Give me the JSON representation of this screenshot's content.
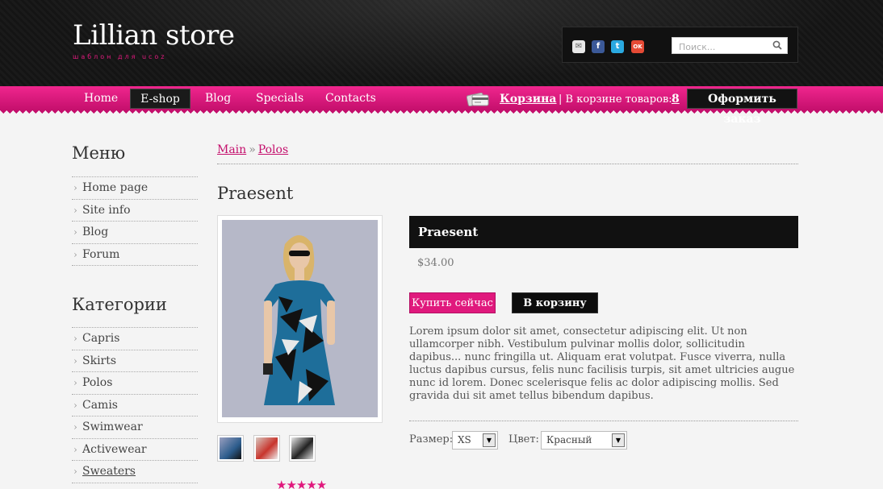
{
  "header": {
    "title": "Lillian store",
    "subtitle": "шаблон для ucoz",
    "search": {
      "placeholder": "Поиск..."
    },
    "social_icons": [
      "mail-icon",
      "facebook-icon",
      "twitter-icon",
      "odnoklassniki-icon"
    ]
  },
  "nav": {
    "items": [
      {
        "label": "Home",
        "active": false
      },
      {
        "label": "E-shop",
        "active": true
      },
      {
        "label": "Blog",
        "active": false
      },
      {
        "label": "Specials",
        "active": false
      },
      {
        "label": "Contacts",
        "active": false
      }
    ]
  },
  "cart": {
    "link": "Корзина",
    "count_label": "| В корзине товаров:",
    "count": "8",
    "checkout": "Оформить заказ"
  },
  "sidebar": {
    "menu_title": "Меню",
    "menu_items": [
      "Home page",
      "Site info",
      "Blog",
      "Forum"
    ],
    "categories_title": "Категории",
    "categories": [
      "Capris",
      "Skirts",
      "Polos",
      "Camis",
      "Swimwear",
      "Activewear",
      "Sweaters"
    ]
  },
  "breadcrumb": {
    "items": [
      "Main",
      "Polos"
    ],
    "separator": "»"
  },
  "product": {
    "heading": "Praesent",
    "name": "Praesent",
    "price": "$34.00",
    "buy_now": "Купить сейчас",
    "add_to_cart": "В корзину",
    "description": "Lorem ipsum dolor sit amet, consectetur adipiscing elit. Ut non ullamcorper nibh. Vestibulum pulvinar mollis dolor, sollicitudin dapibus... nunc fringilla ut. Aliquam erat volutpat. Fusce viverra, nulla luctus dapibus cursus, felis nunc facilisis turpis, sit amet ultricies augue nunc id lorem. Donec scelerisque felis ac dolor adipiscing mollis. Sed gravida dui sit amet tellus bibendum dapibus.",
    "size_label": "Размер:",
    "size_value": "XS",
    "color_label": "Цвет:",
    "color_value": "Красный",
    "rating": "★★★★★"
  },
  "colors": {
    "accent": "#e0197d",
    "header_bg": "#161616",
    "title_bar": "#111111"
  }
}
